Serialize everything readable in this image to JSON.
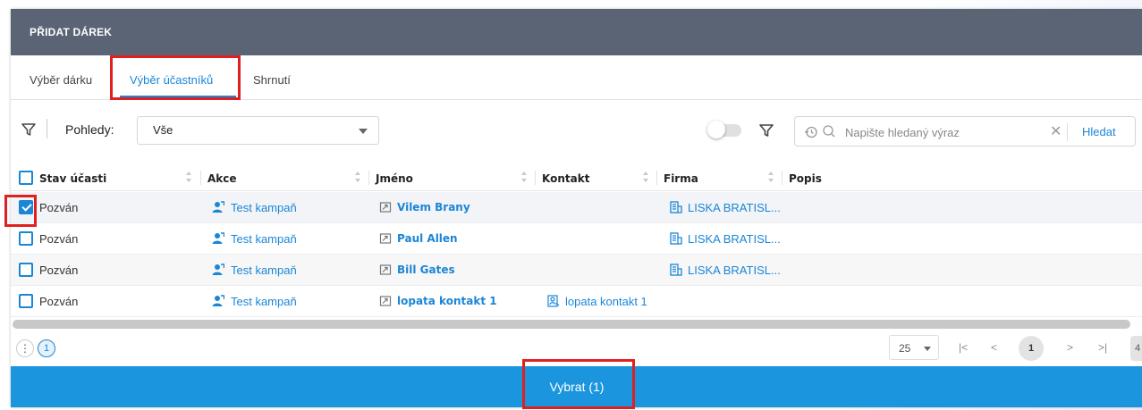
{
  "dialog": {
    "title": "PŘIDAT DÁREK"
  },
  "tabs": [
    {
      "label": "Výběr dárku"
    },
    {
      "label": "Výběr účastníků",
      "active": true
    },
    {
      "label": "Shrnutí"
    }
  ],
  "toolbar": {
    "views_label": "Pohledy:",
    "views_value": "Vše",
    "search_placeholder": "Napište hledaný výraz",
    "search_button": "Hledat"
  },
  "table": {
    "columns": [
      "Stav účasti",
      "Akce",
      "Jméno",
      "Kontakt",
      "Firma",
      "Popis"
    ],
    "rows": [
      {
        "checked": true,
        "status": "Pozván",
        "akce": "Test kampaň",
        "jmeno": "Vilem Brany",
        "kontakt": "",
        "firma": "LISKA BRATISL..."
      },
      {
        "checked": false,
        "status": "Pozván",
        "akce": "Test kampaň",
        "jmeno": "Paul Allen",
        "kontakt": "",
        "firma": "LISKA BRATISL..."
      },
      {
        "checked": false,
        "status": "Pozván",
        "akce": "Test kampaň",
        "jmeno": "Bill Gates",
        "kontakt": "",
        "firma": "LISKA BRATISL..."
      },
      {
        "checked": false,
        "status": "Pozván",
        "akce": "Test kampaň",
        "jmeno": "lopata kontakt 1",
        "kontakt": "lopata kontakt 1",
        "firma": ""
      }
    ]
  },
  "footer": {
    "more": "⋮",
    "page_bubble": "1",
    "page_size": "25",
    "current_page": "1",
    "total_partial": "4"
  },
  "action": {
    "select_label": "Vybrat (1)"
  },
  "colors": {
    "accent": "#1b86d6",
    "header": "#5b6474",
    "select_bar": "#1b96de",
    "highlight": "#e02020"
  },
  "icons": [
    "filter-icon",
    "history-icon",
    "search-icon",
    "clear-icon",
    "user-campaign-icon",
    "contact-card-icon",
    "company-icon",
    "contact-link-icon",
    "sort-icon"
  ]
}
